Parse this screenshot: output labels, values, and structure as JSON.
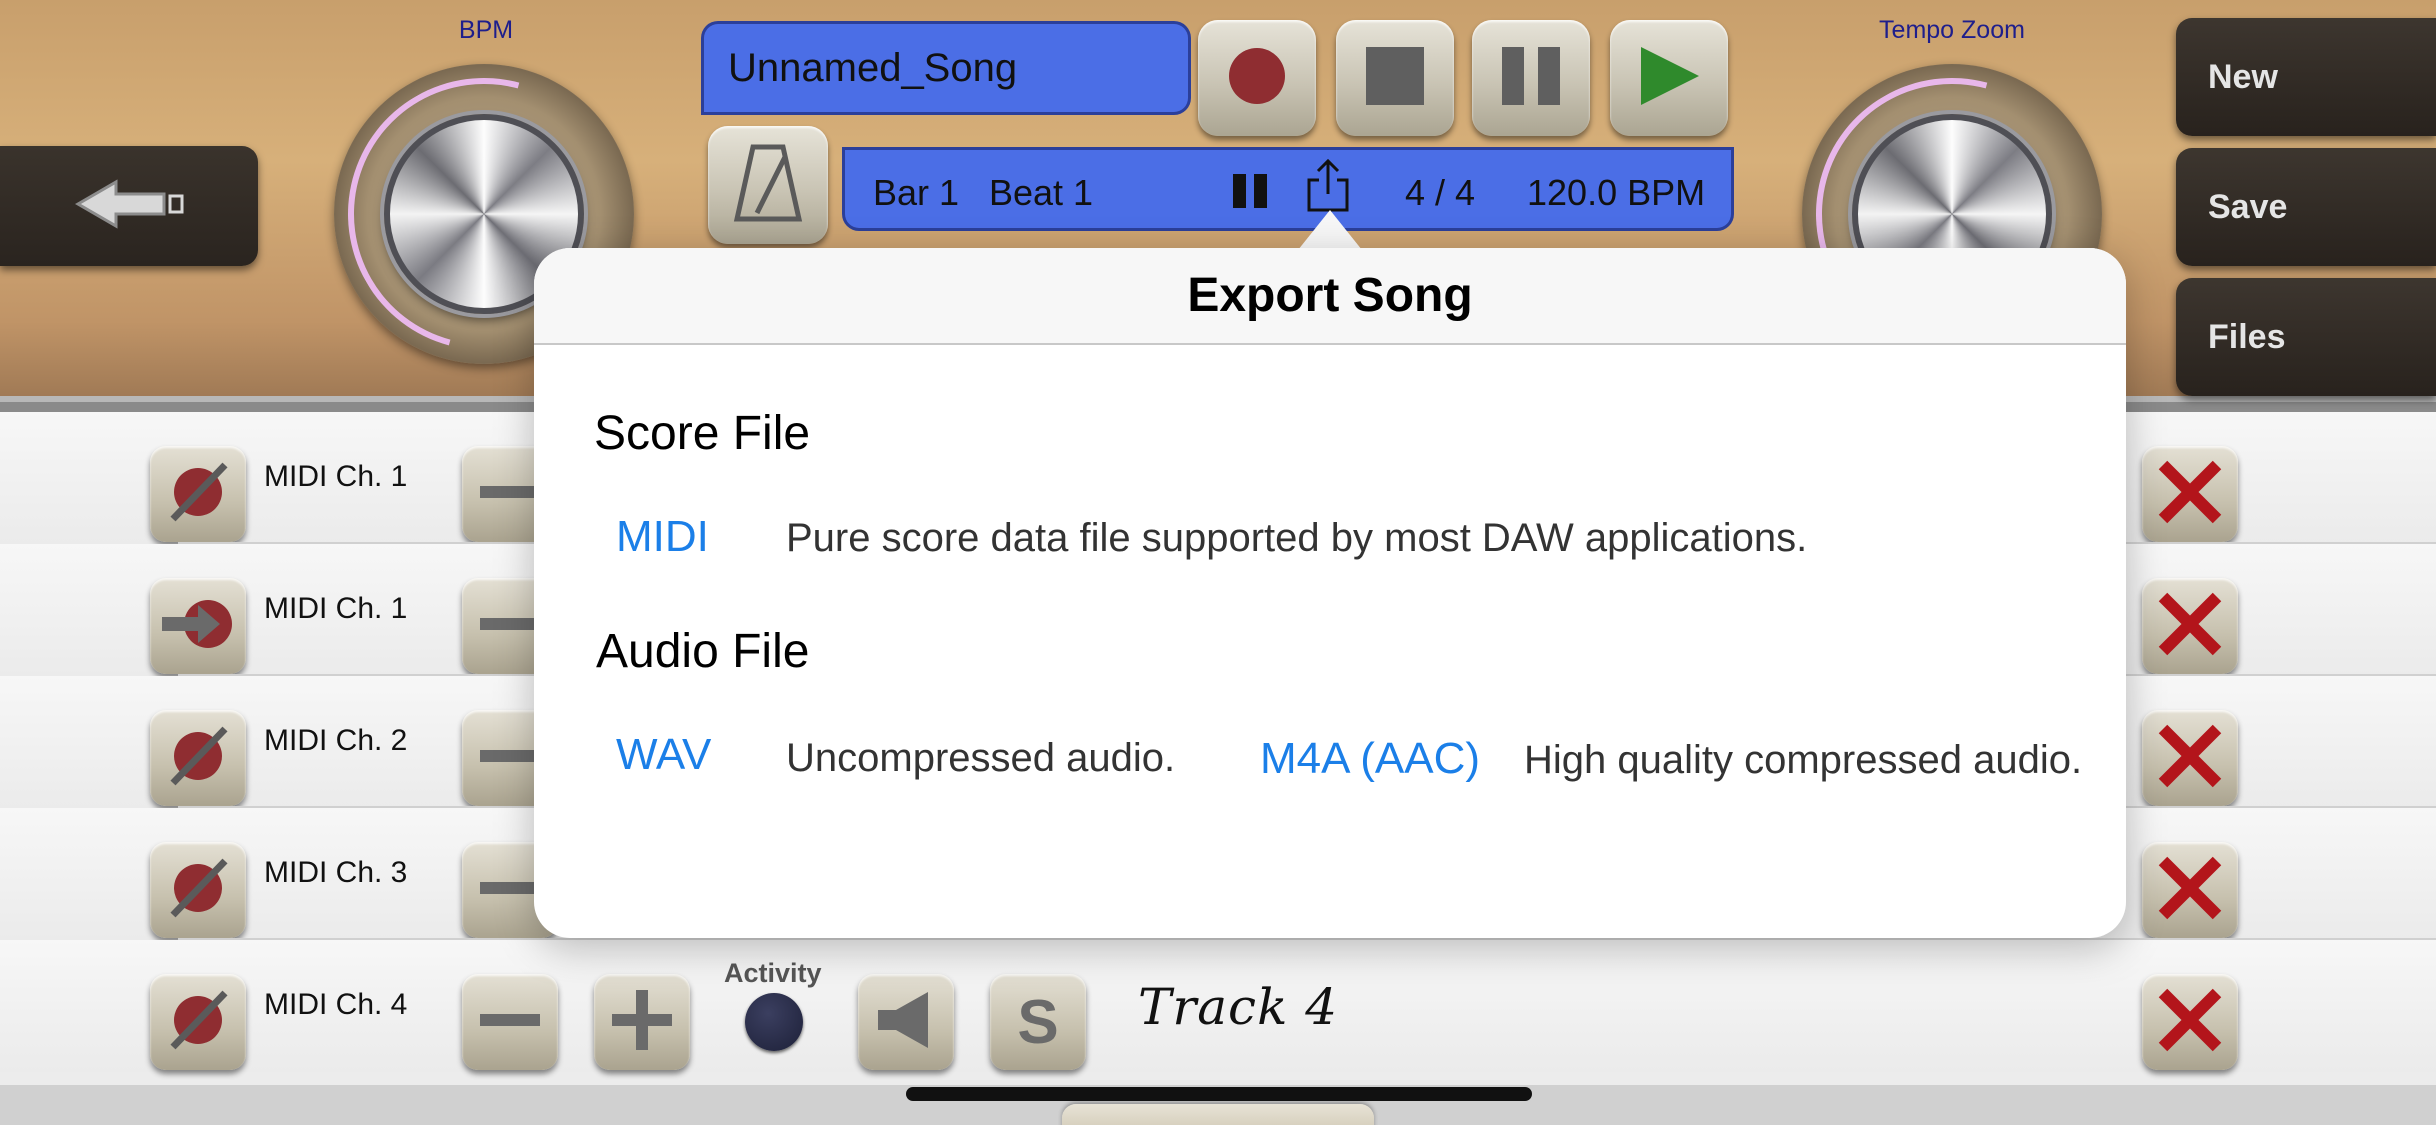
{
  "header": {
    "bpm_label": "BPM",
    "tempo_zoom_label": "Tempo Zoom",
    "song_name": "Unnamed_Song",
    "bar": "Bar 1",
    "beat": "Beat 1",
    "time_signature": "4 / 4",
    "tempo": "120.0 BPM",
    "buttons": {
      "new": "New",
      "save": "Save",
      "files": "Files"
    }
  },
  "colors": {
    "display_blue": "#4b6ee6",
    "link_blue": "#1b7fe8",
    "delete_red": "#b3151b",
    "record_red": "#8f2d31",
    "play_green": "#2f8a2c",
    "knob_arc": "#e8b7ea",
    "knob_label": "#1e1e8c"
  },
  "icons": {
    "back": "arrow-left-icon",
    "metronome": "metronome-icon",
    "record": "record-icon",
    "stop": "stop-icon",
    "pause": "pause-icon",
    "play": "play-icon",
    "share": "share-icon",
    "mute": "mute-icon",
    "arm": "arrow-right-icon",
    "minus": "minus-icon",
    "plus": "plus-icon",
    "speaker": "speaker-icon",
    "solo": "solo-icon",
    "delete": "delete-x-icon"
  },
  "tracks": [
    {
      "label": "MIDI Ch. 1",
      "state": "muted"
    },
    {
      "label": "MIDI Ch. 1",
      "state": "armed"
    },
    {
      "label": "MIDI Ch. 2",
      "state": "muted"
    },
    {
      "label": "MIDI Ch. 3",
      "state": "muted"
    },
    {
      "label": "MIDI Ch. 4",
      "state": "muted",
      "activity_label": "Activity",
      "solo": "S",
      "name": "Track 4"
    }
  ],
  "export_popover": {
    "title": "Export Song",
    "score_section": "Score File",
    "audio_section": "Audio File",
    "formats": {
      "midi": {
        "label": "MIDI",
        "description": "Pure score data file supported by most DAW applications."
      },
      "wav": {
        "label": "WAV",
        "description": "Uncompressed audio."
      },
      "m4a": {
        "label": "M4A (AAC)",
        "description": "High quality compressed audio."
      }
    }
  }
}
